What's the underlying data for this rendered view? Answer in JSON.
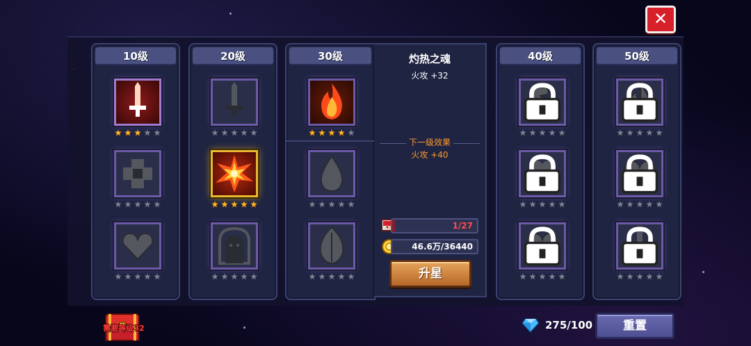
{
  "columns": [
    {
      "label": "10级"
    },
    {
      "label": "20级"
    },
    {
      "label": "30级"
    },
    {
      "label": "40级"
    },
    {
      "label": "50级"
    }
  ],
  "skills": [
    {
      "icon": "sword-crystal-icon",
      "stars": 3,
      "max_stars": 5,
      "locked": false,
      "selected": false
    },
    {
      "icon": "shield-cross-icon",
      "stars": 0,
      "max_stars": 5,
      "locked": false,
      "selected": false
    },
    {
      "icon": "heart-icon",
      "stars": 0,
      "max_stars": 5,
      "locked": false,
      "selected": false
    },
    {
      "icon": "sword-crystal-icon",
      "stars": 0,
      "max_stars": 5,
      "locked": false,
      "selected": false
    },
    {
      "icon": "explosion-icon",
      "stars": 5,
      "max_stars": 5,
      "locked": false,
      "selected": true
    },
    {
      "icon": "ghost-portal-icon",
      "stars": 0,
      "max_stars": 5,
      "locked": false,
      "selected": false
    },
    {
      "icon": "flame-icon",
      "stars": 4,
      "max_stars": 5,
      "locked": false,
      "selected": false
    },
    {
      "icon": "water-drop-icon",
      "stars": 0,
      "max_stars": 5,
      "locked": false,
      "selected": false
    },
    {
      "icon": "leaf-icon",
      "stars": 0,
      "max_stars": 5,
      "locked": false,
      "selected": false
    },
    {
      "icon": "muscle-arm-icon",
      "stars": 0,
      "max_stars": 5,
      "locked": true,
      "selected": false
    },
    {
      "icon": "clover-icon",
      "stars": 0,
      "max_stars": 5,
      "locked": true,
      "selected": false
    },
    {
      "icon": "heart-icon",
      "stars": 0,
      "max_stars": 5,
      "locked": true,
      "selected": false
    },
    {
      "icon": "dark-flame-icon",
      "stars": 0,
      "max_stars": 5,
      "locked": true,
      "selected": false
    },
    {
      "icon": "heart-icon",
      "stars": 0,
      "max_stars": 5,
      "locked": true,
      "selected": false
    },
    {
      "icon": "sword-crystal-icon",
      "stars": 0,
      "max_stars": 5,
      "locked": true,
      "selected": false
    }
  ],
  "detail": {
    "name": "灼热之魂",
    "attr": "火攻 +32",
    "next_label": "下一级效果",
    "next_attr": "火攻 +40",
    "fragments": "1/27",
    "fragments_progress": 0.037,
    "gold": "46.6万/36440",
    "upgrade_label": "升星"
  },
  "bottom": {
    "chest_label": "需要等级32",
    "gems": "275/100",
    "reset_label": "重置"
  },
  "close_label": "✕",
  "colors": {
    "star_on": "#ffb72a",
    "star_off": "#7f8194",
    "accent_purple": "#6c5aa8",
    "gold_frame": "#e8b830"
  }
}
